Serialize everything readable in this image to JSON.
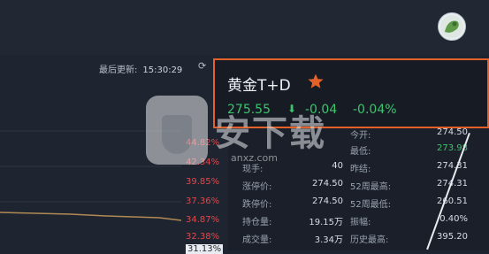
{
  "header": {
    "last_update_label": "最后更新:",
    "last_update_time": "15:30:29"
  },
  "chart": {
    "percent_labels": [
      "44.82%",
      "42.34%",
      "39.85%",
      "37.36%",
      "34.87%",
      "32.38%",
      "31.13%"
    ],
    "line_color": "#b08a55",
    "down_color": "#e0474c"
  },
  "popup": {
    "title": "黄金T+D",
    "star_icon": "star-icon",
    "price": "275.55",
    "arrow_icon": "down-arrow-icon",
    "change": "-0.04",
    "change_percent": "-0.04%",
    "accent_color": "#e4622a",
    "change_color": "#3ec46d"
  },
  "watermark": {
    "text": "安下载",
    "sub": "anxz.com"
  },
  "stats": [
    {
      "label1": "",
      "value1": "",
      "label2": "今开:",
      "value2": "274.50",
      "green": false
    },
    {
      "label1": "",
      "value1": "",
      "label2": "最低:",
      "value2": "273.98",
      "green": true
    },
    {
      "label1": "现手:",
      "value1": "40",
      "label2": "昨结:",
      "value2": "274.31",
      "green": false
    },
    {
      "label1": "涨停价:",
      "value1": "274.50",
      "label2": "52周最高:",
      "value2": "274.31",
      "green": false
    },
    {
      "label1": "跌停价:",
      "value1": "274.50",
      "label2": "52周最低:",
      "value2": "260.51",
      "green": false
    },
    {
      "label1": "持仓量:",
      "value1": "19.15万",
      "label2": "振幅:",
      "value2": "0.40%",
      "green": false
    },
    {
      "label1": "成交量:",
      "value1": "3.34万",
      "label2": "历史最高:",
      "value2": "395.20",
      "green": false
    }
  ]
}
